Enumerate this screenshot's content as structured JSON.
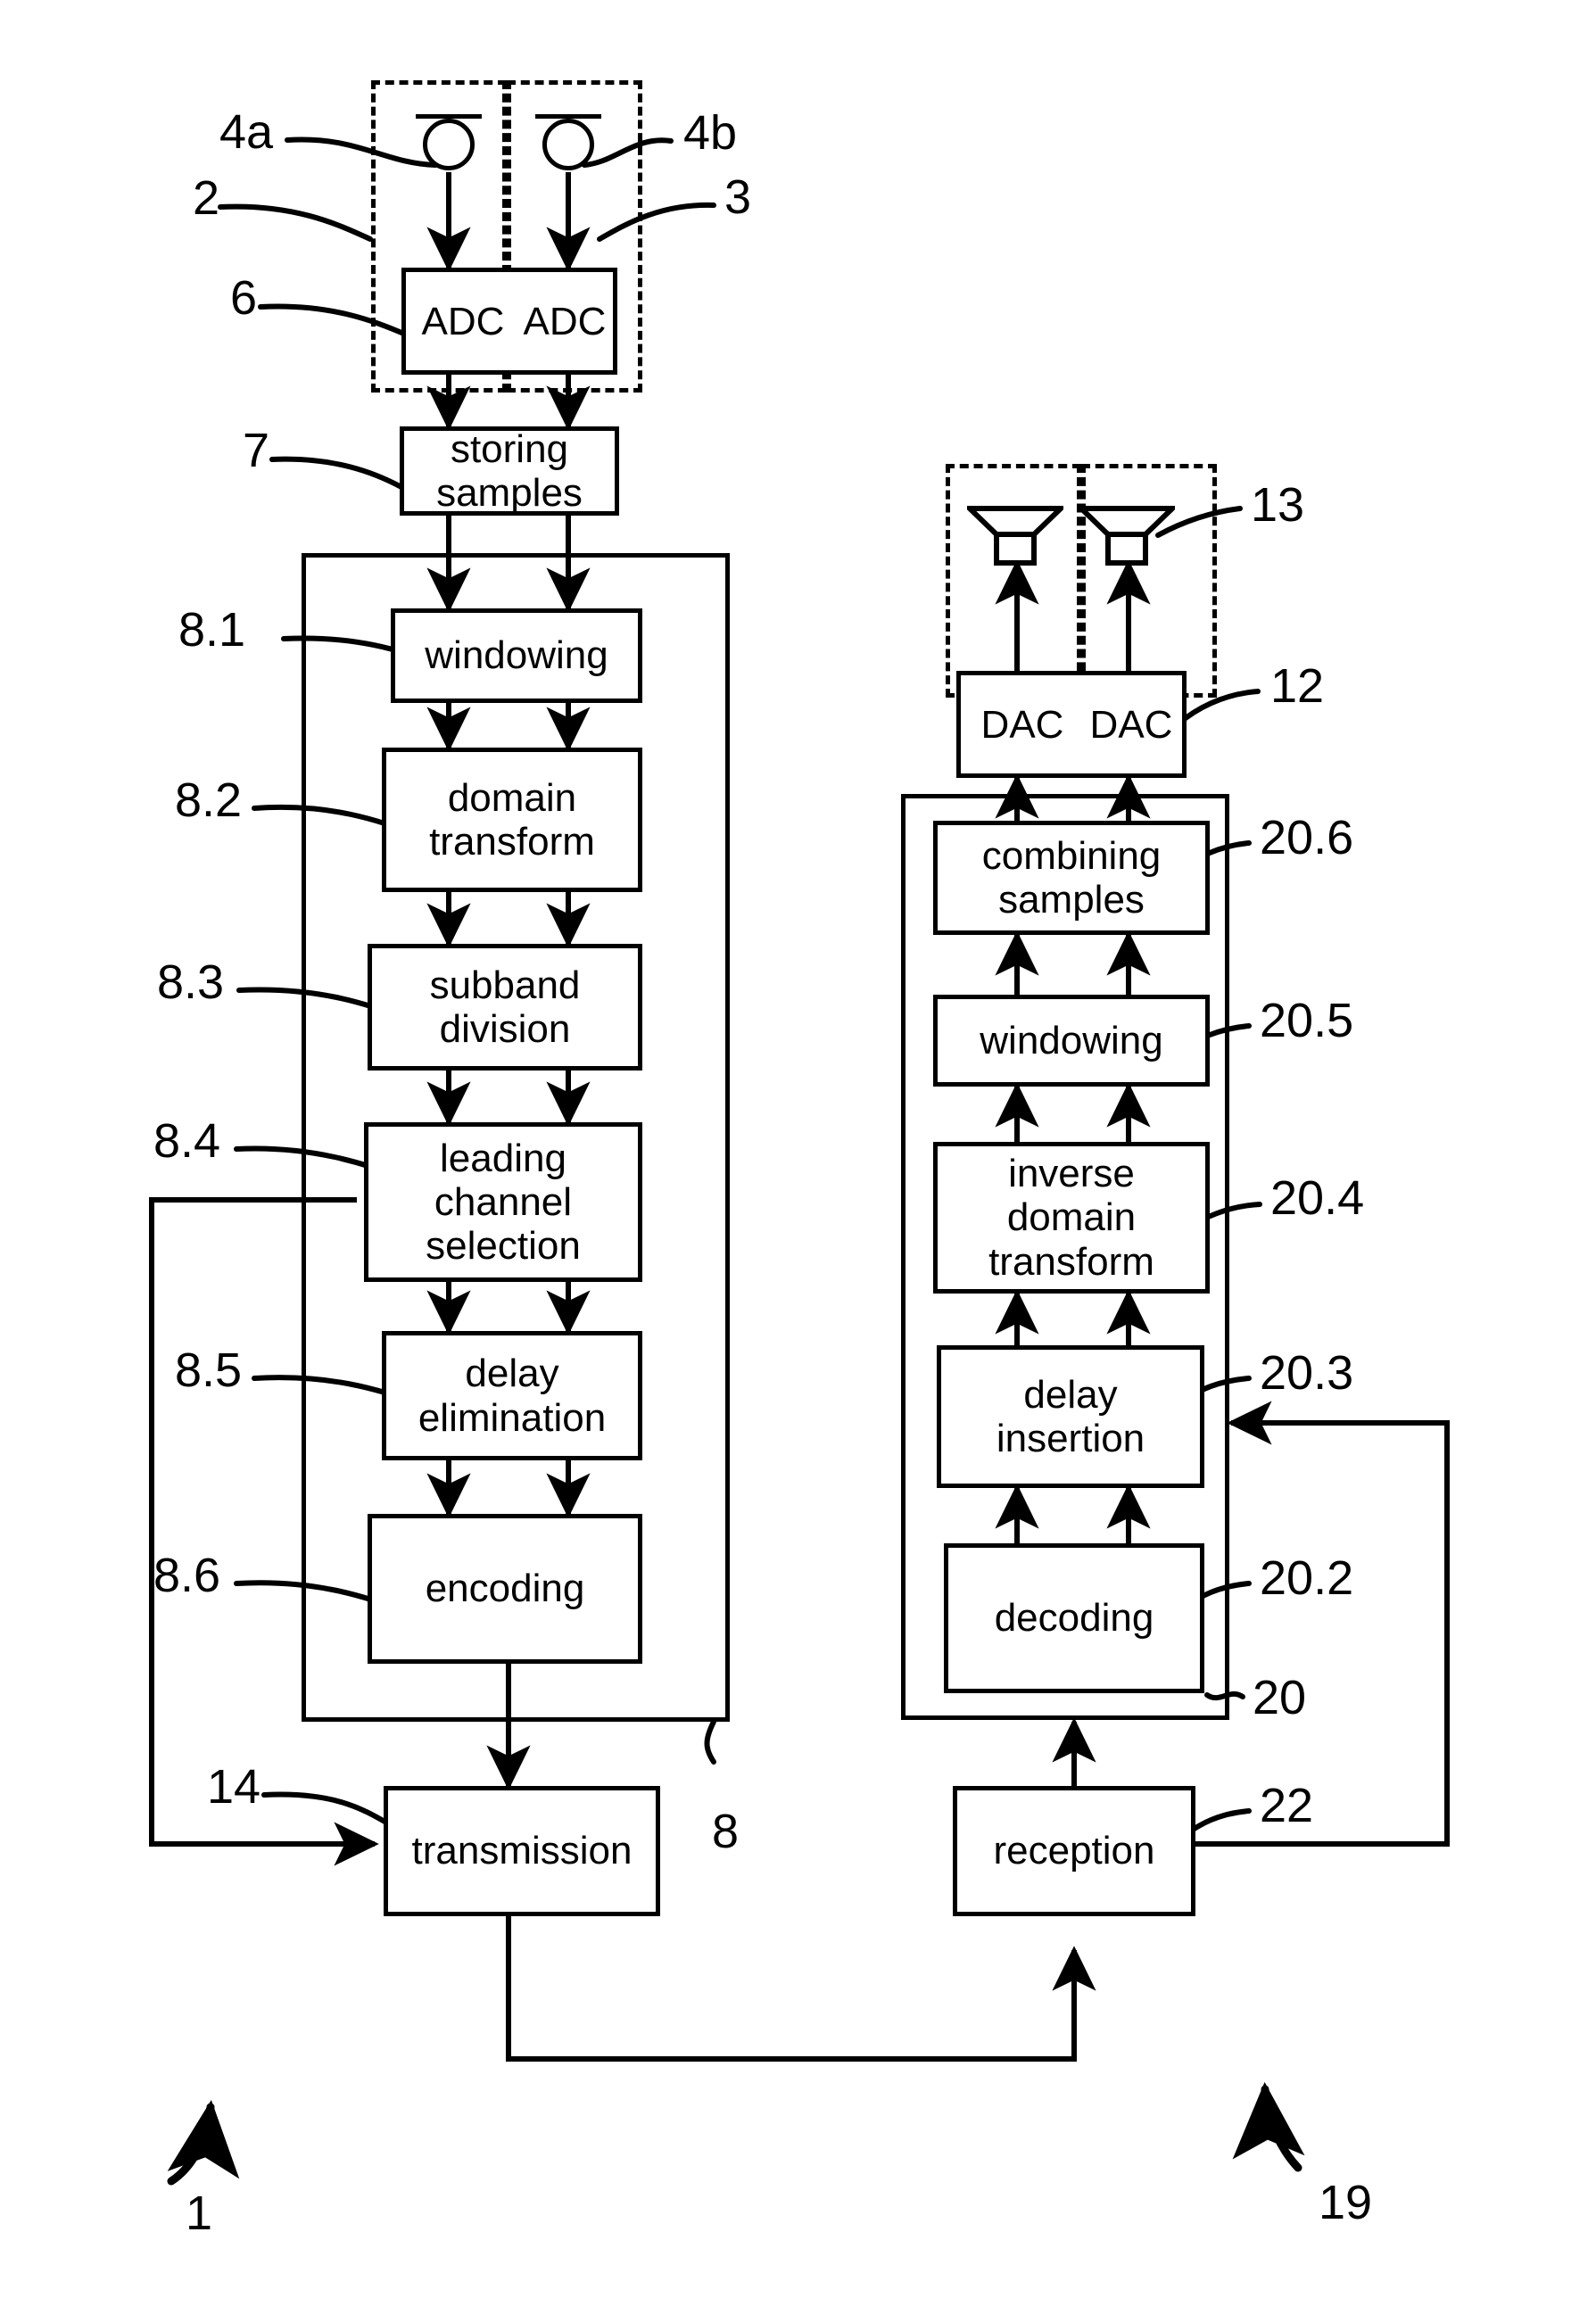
{
  "figure": {
    "title": "Audio capture, encoding, transmission, decoding and reproduction block diagram",
    "line_color": "#000000",
    "background_color": "#ffffff"
  },
  "blocks": {
    "adc_left": "ADC",
    "adc_right": "ADC",
    "storing_samples": "storing\nsamples",
    "windowing_tx": "windowing",
    "domain_transform": "domain\ntransform",
    "subband_division": "subband\ndivision",
    "leading_channel_selection": "leading\nchannel\nselection",
    "delay_elimination": "delay\nelimination",
    "encoding": "encoding",
    "transmission": "transmission",
    "reception": "reception",
    "decoding": "decoding",
    "delay_insertion": "delay\ninsertion",
    "inverse_domain_transform": "inverse\ndomain\ntransform",
    "windowing_rx": "windowing",
    "combining_samples": "combining\nsamples",
    "dac_left": "DAC",
    "dac_right": "DAC"
  },
  "reference_numerals": {
    "n4a": "4a",
    "n4b": "4b",
    "n2": "2",
    "n3": "3",
    "n6": "6",
    "n7": "7",
    "n8_1": "8.1",
    "n8_2": "8.2",
    "n8_3": "8.3",
    "n8_4": "8.4",
    "n8_5": "8.5",
    "n8_6": "8.6",
    "n8": "8",
    "n14": "14",
    "n1": "1",
    "n13": "13",
    "n12": "12",
    "n20_6": "20.6",
    "n20_5": "20.5",
    "n20_4": "20.4",
    "n20_3": "20.3",
    "n20_2": "20.2",
    "n20": "20",
    "n22": "22",
    "n19": "19"
  },
  "icons": {
    "microphone_left": "microphone-icon",
    "microphone_right": "microphone-icon",
    "loudspeaker_left": "loudspeaker-icon",
    "loudspeaker_right": "loudspeaker-icon"
  }
}
